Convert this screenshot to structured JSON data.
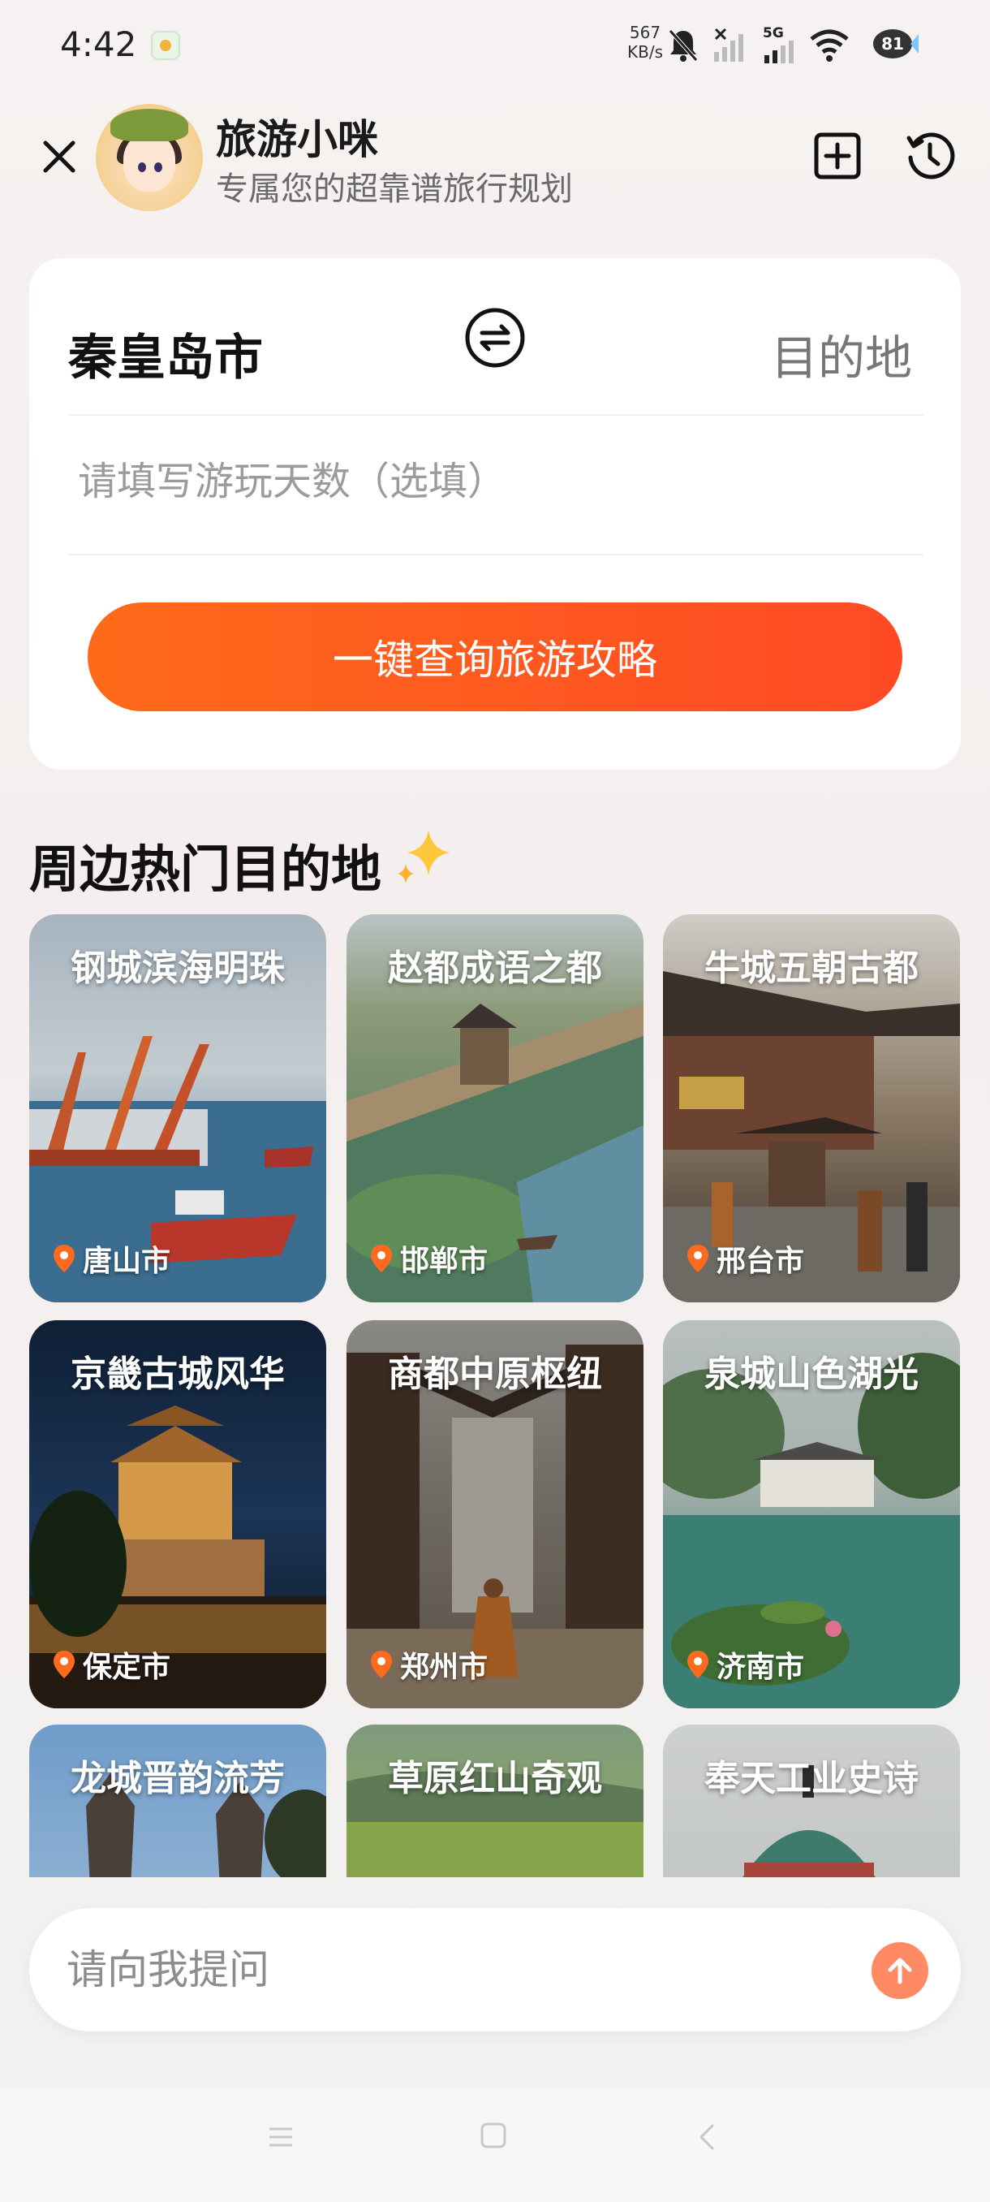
{
  "status_bar": {
    "time": "4:42",
    "network_speed_value": "567",
    "network_speed_unit": "KB/s",
    "network_type": "5G",
    "battery": "81"
  },
  "header": {
    "title": "旅游小咪",
    "subtitle": "专属您的超靠谱旅行规划"
  },
  "search": {
    "origin": "秦皇岛市",
    "destination_placeholder": "目的地",
    "days_placeholder": "请填写游玩天数（选填）",
    "query_button": "一键查询旅游攻略"
  },
  "section": {
    "title": "周边热门目的地"
  },
  "destinations": [
    {
      "title": "钢城滨海明珠",
      "city": "唐山市"
    },
    {
      "title": "赵都成语之都",
      "city": "邯郸市"
    },
    {
      "title": "牛城五朝古都",
      "city": "邢台市"
    },
    {
      "title": "京畿古城风华",
      "city": "保定市"
    },
    {
      "title": "商都中原枢纽",
      "city": "郑州市"
    },
    {
      "title": "泉城山色湖光",
      "city": "济南市"
    },
    {
      "title": "龙城晋韵流芳",
      "city": ""
    },
    {
      "title": "草原红山奇观",
      "city": ""
    },
    {
      "title": "奉天工业史诗",
      "city": ""
    }
  ],
  "ask": {
    "placeholder": "请向我提问"
  },
  "colors": {
    "accent": "#ff5a1f",
    "send_button": "#ff8a64"
  }
}
